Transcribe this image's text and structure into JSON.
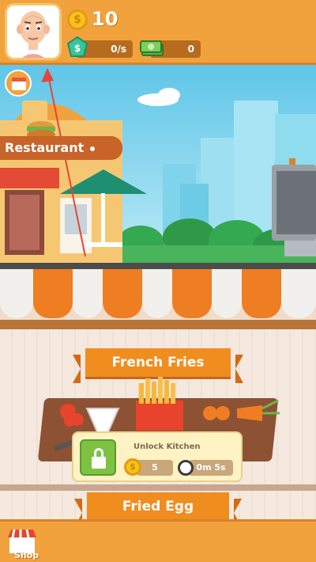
{
  "header": {
    "coin_count": "10",
    "income_rate": "0/s",
    "cash_count": "0"
  },
  "scene": {
    "restaurant_sign": "Restaurant"
  },
  "kitchen": {
    "dish_1_title": "French Fries",
    "unlock_title": "Unlock Kitchen",
    "unlock_cost": "5",
    "unlock_time": "0m 5s",
    "dish_2_title": "Fried Egg"
  },
  "bottom_nav": {
    "shop_label": "Shop"
  },
  "colors": {
    "bar_orange": "#f2a23c",
    "ribbon_orange": "#f08d1f",
    "unlock_green": "#7dc243",
    "sky": "#5fc6e8"
  },
  "icons": [
    "coin-icon",
    "gem-icon",
    "cash-icon",
    "calendar-icon",
    "lock-icon",
    "clock-icon",
    "shop-icon"
  ]
}
